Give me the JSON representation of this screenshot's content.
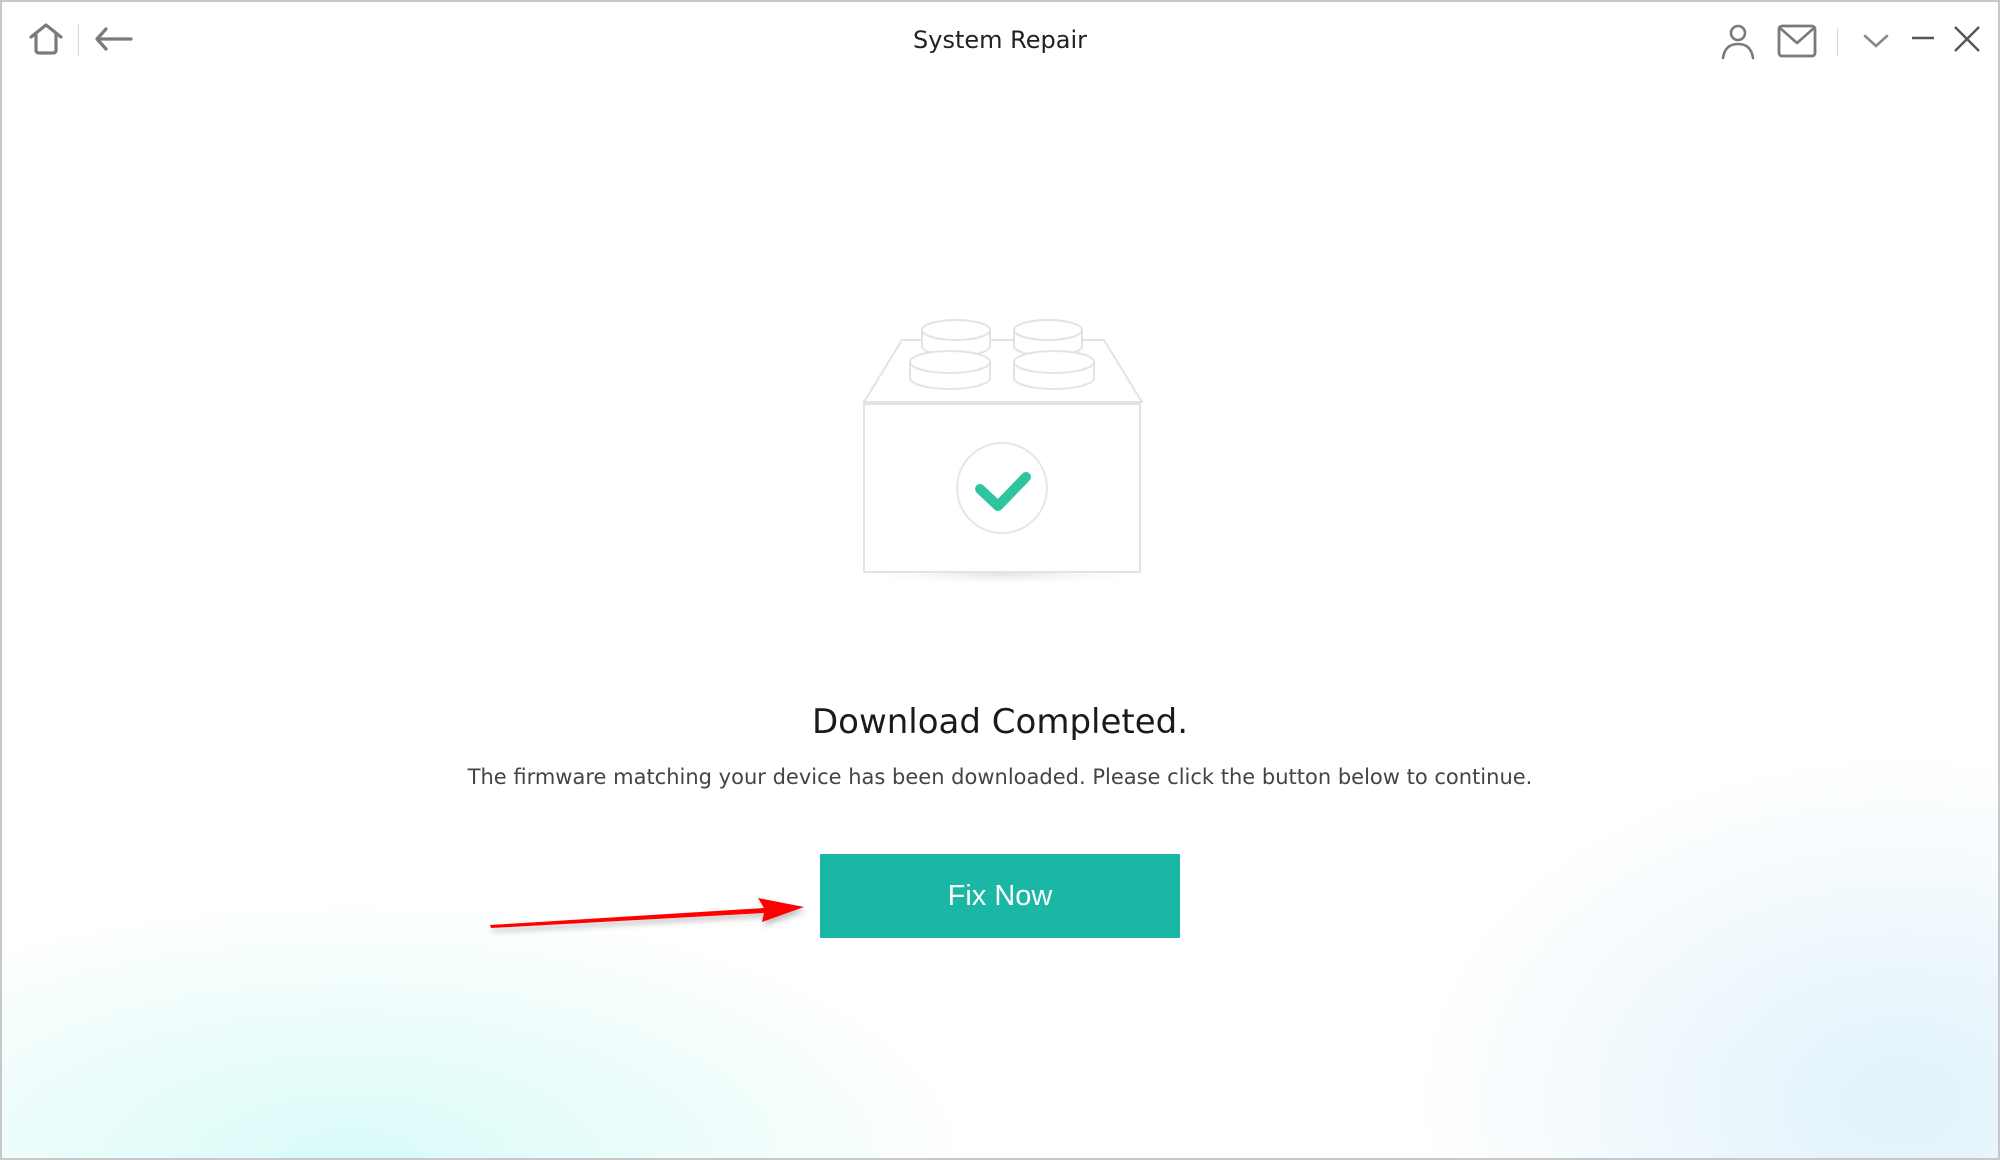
{
  "window": {
    "title": "System Repair",
    "icons": {
      "home": "home-icon",
      "back": "back-arrow-icon",
      "account": "user-icon",
      "mail": "mail-icon",
      "menu": "chevron-down-icon",
      "minimize": "minimize-icon",
      "close": "close-icon"
    }
  },
  "main": {
    "illustration": "firmware-block-check-icon",
    "heading": "Download Completed.",
    "description": "The firmware matching your device has been downloaded. Please click the button below to continue.",
    "fix_button_label": "Fix Now",
    "annotation": "red-arrow-pointing-to-fix-now"
  },
  "colors": {
    "accent": "#1bb7a5",
    "check": "#2ec4a0",
    "annotation_arrow": "#ff0000"
  }
}
